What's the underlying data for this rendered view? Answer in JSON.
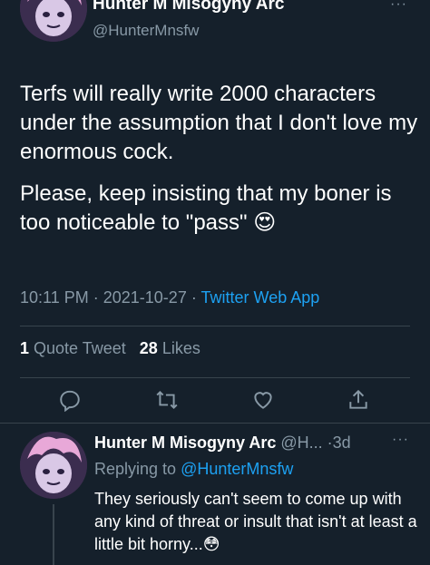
{
  "main_tweet": {
    "author_name": "Hunter M Misogyny Arc",
    "author_handle": "@HunterMnsfw",
    "more_label": "···",
    "text_p1": "Terfs will really write 2000 characters under the assumption that I don't love my enormous cock.",
    "text_p2": "Please, keep insisting that my boner is too noticeable to \"pass\"",
    "emoji": "😍",
    "time": "10:11 PM",
    "date": "2021-10-27",
    "separator": "·",
    "app": "Twitter Web App",
    "quote_count": "1",
    "quote_label": "Quote Tweet",
    "like_count": "28",
    "like_label": "Likes"
  },
  "reply_tweet": {
    "author_name": "Hunter M Misogyny Arc",
    "author_handle": "@H...",
    "separator": "·",
    "time": "3d",
    "more_label": "···",
    "replying_label": "Replying to",
    "replying_handle": "@HunterMnsfw",
    "text": "They seriously can't seem to come up with any kind of threat or insult that isn't at least a little bit horny...",
    "emoji": "😳"
  },
  "actions": [
    "reply-icon",
    "retweet-icon",
    "like-icon",
    "share-icon"
  ],
  "colors": {
    "background": "#15202b",
    "text_primary": "#ffffff",
    "text_secondary": "#8899a6",
    "accent": "#1da1f2",
    "divider": "#38444d"
  }
}
